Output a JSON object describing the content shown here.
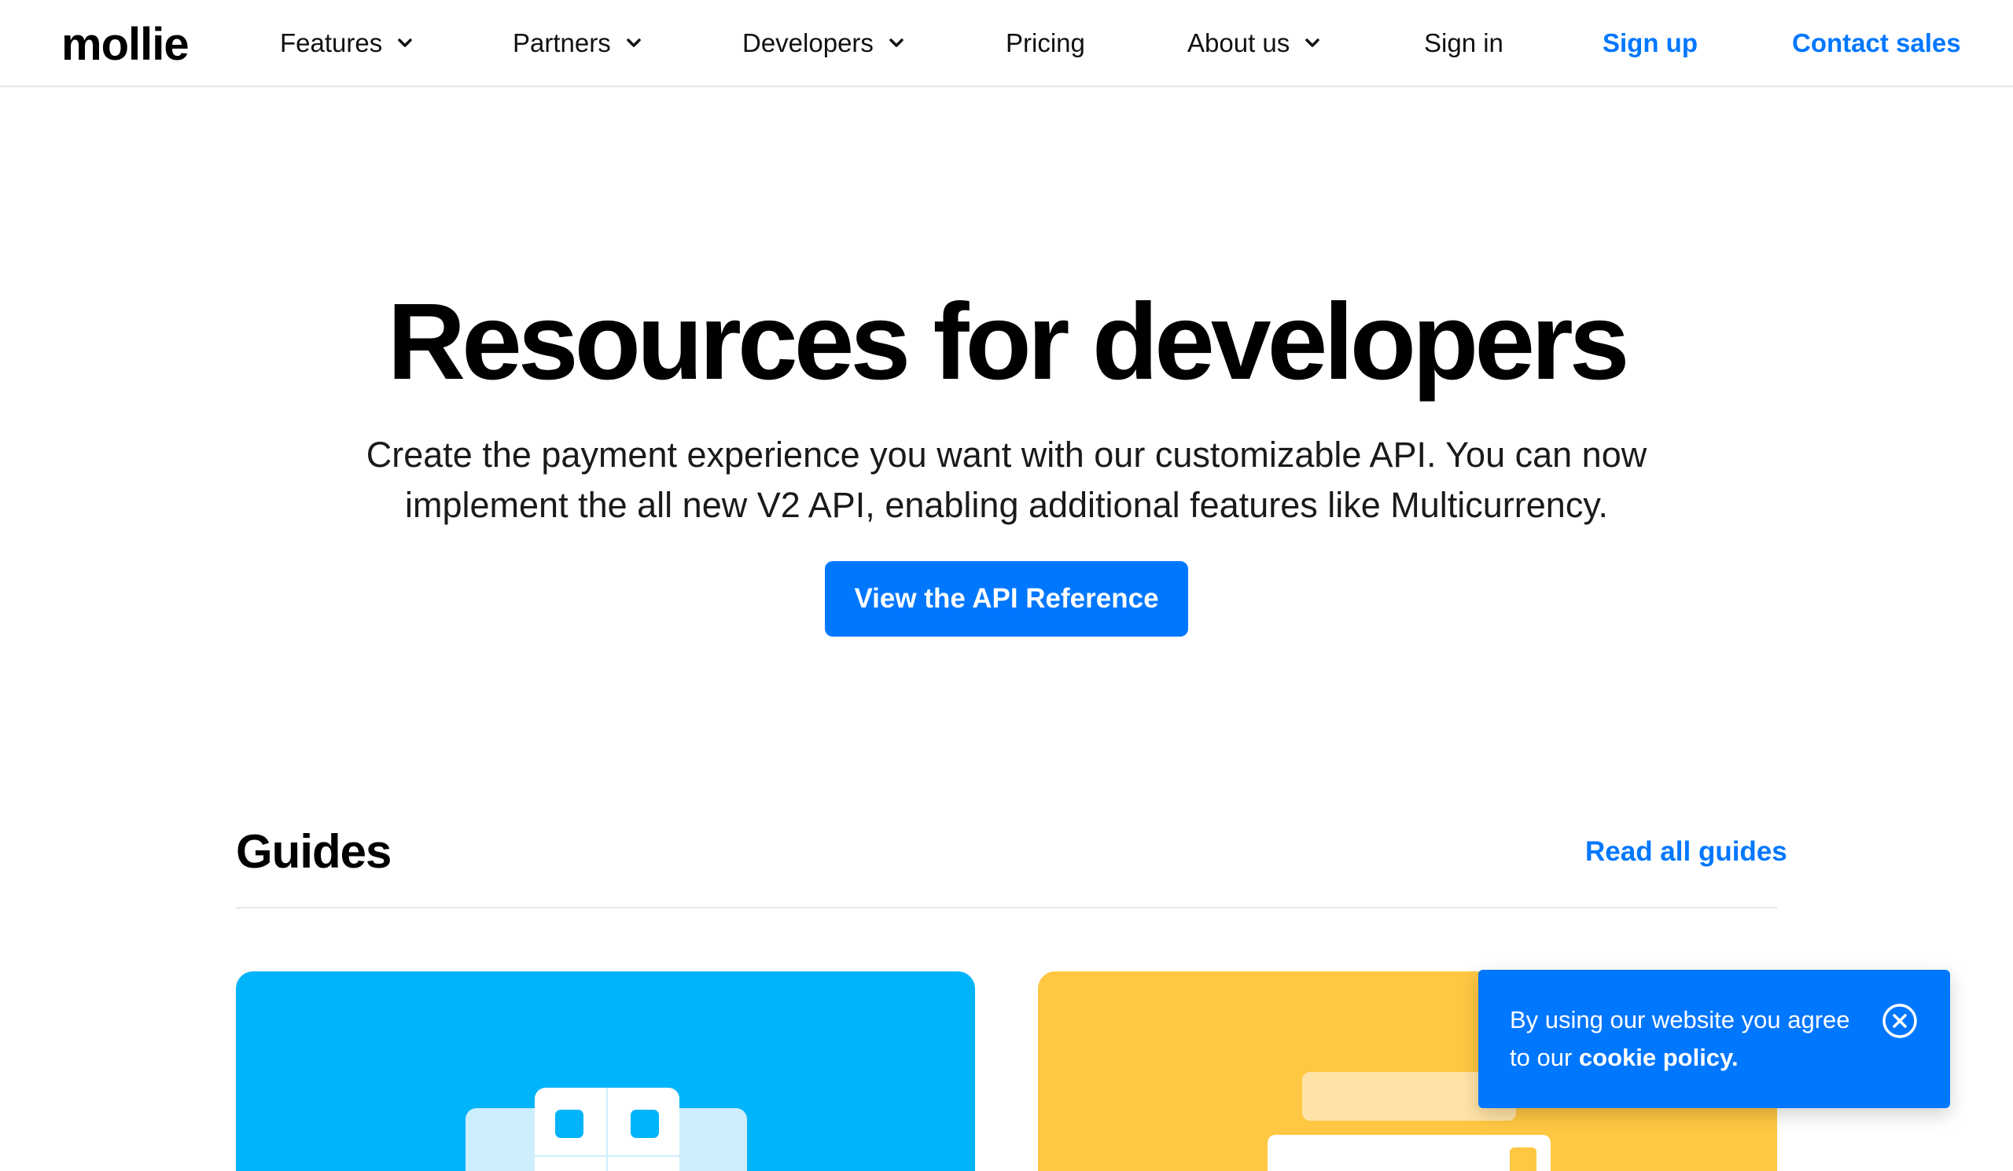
{
  "header": {
    "logo": "mollie",
    "nav": [
      {
        "label": "Features",
        "dropdown": true
      },
      {
        "label": "Partners",
        "dropdown": true
      },
      {
        "label": "Developers",
        "dropdown": true
      },
      {
        "label": "Pricing",
        "dropdown": false
      },
      {
        "label": "About us",
        "dropdown": true
      },
      {
        "label": "Sign in",
        "dropdown": false
      }
    ],
    "sign_up": "Sign up",
    "contact_sales": "Contact sales"
  },
  "hero": {
    "title": "Resources for developers",
    "subtitle_line1": "Create the payment experience you want with our customizable API. You can now",
    "subtitle_line2": "implement the all new V2 API, enabling additional features like Multicurrency.",
    "cta": "View the API Reference"
  },
  "guides": {
    "title": "Guides",
    "read_all": "Read all guides"
  },
  "cookie": {
    "text_prefix": "By using our website you agree to our ",
    "link": "cookie policy."
  },
  "colors": {
    "accent": "#0077ff",
    "card_blue": "#00b4fa",
    "card_yellow": "#ffc742"
  },
  "icons": {
    "dropdown": "chevron-down-icon",
    "close": "close-circle-icon"
  }
}
